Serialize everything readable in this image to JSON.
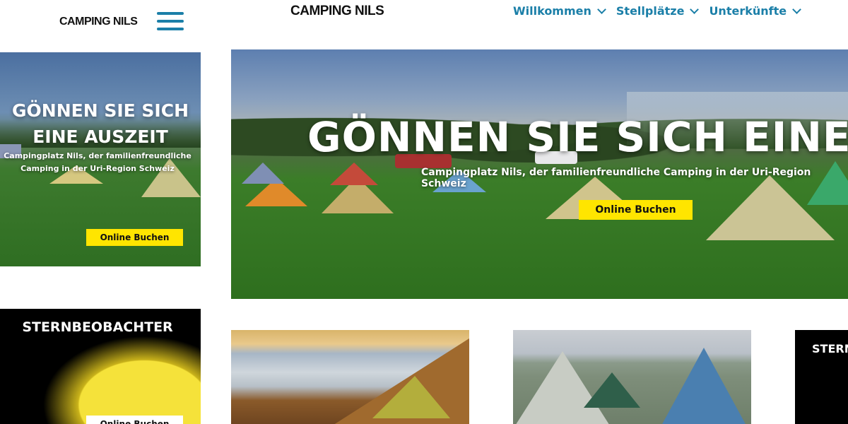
{
  "header": {
    "logo_left": "CAMPING NILS",
    "logo_center": "CAMPING NILS",
    "nav": [
      {
        "label": "Willkommen"
      },
      {
        "label": "Stellplätze"
      },
      {
        "label": "Unterkünfte"
      }
    ]
  },
  "mobile_hero": {
    "title_line1": "GÖNNEN SIE SICH",
    "title_line2": "EINE AUSZEIT",
    "subtitle_line1": "Campingplatz Nils, der familienfreundliche",
    "subtitle_line2": "Camping in der Uri-Region Schweiz",
    "button": "Online Buchen"
  },
  "desktop_hero": {
    "title": "GÖNNEN SIE SICH EINE AU",
    "subtitle": "Campingplatz Nils, der familienfreundliche Camping in der Uri-Region Schweiz",
    "button": "Online Buchen"
  },
  "mobile_card": {
    "title": "STERNBEOBACHTER",
    "button": "Online Buchen"
  },
  "right_card": {
    "title": "STERN"
  },
  "icons": [
    "hamburger-menu-icon",
    "chevron-down-icon"
  ],
  "colors": {
    "accent": "#1b7fa8",
    "button": "#ffe500"
  }
}
